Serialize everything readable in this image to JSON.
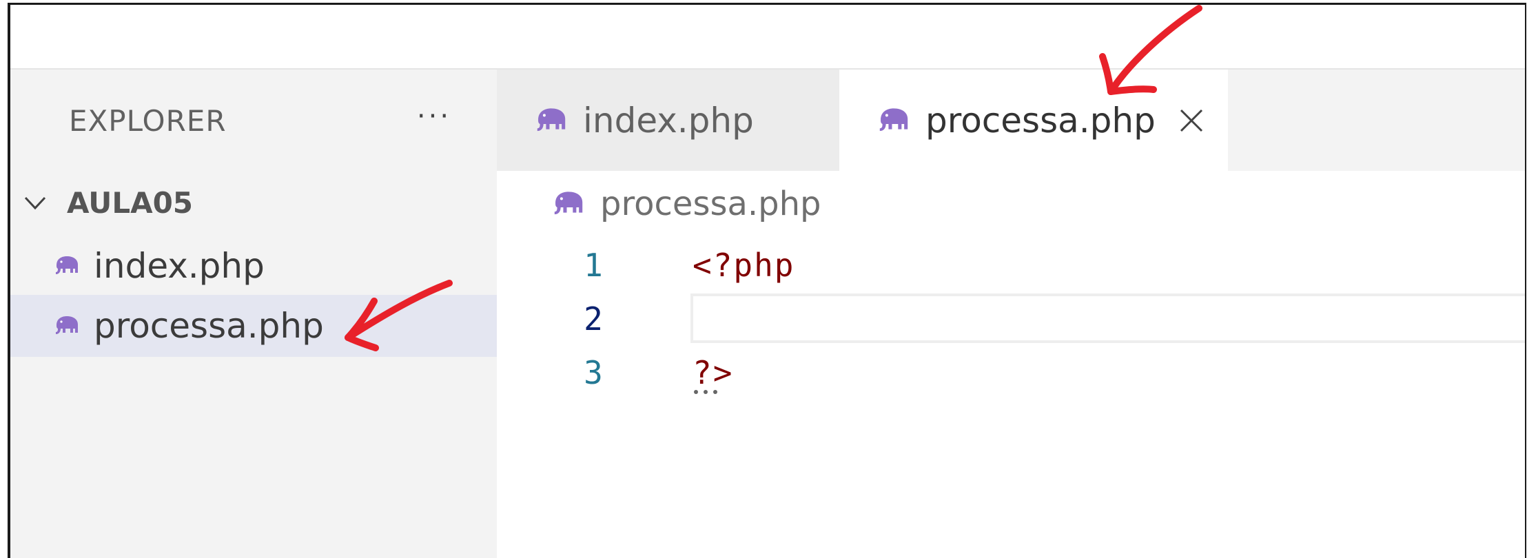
{
  "sidebar": {
    "title": "EXPLORER",
    "more_label": "···",
    "folder": {
      "name": "AULA05",
      "expanded": true
    },
    "files": [
      {
        "name": "index.php",
        "icon": "php-elephant-icon",
        "selected": false
      },
      {
        "name": "processa.php",
        "icon": "php-elephant-icon",
        "selected": true
      }
    ]
  },
  "tabs": [
    {
      "label": "index.php",
      "icon": "php-elephant-icon",
      "active": false
    },
    {
      "label": "processa.php",
      "icon": "php-elephant-icon",
      "active": true,
      "close_icon": "close-icon"
    }
  ],
  "breadcrumb": {
    "file": "processa.php",
    "icon": "php-elephant-icon"
  },
  "code": {
    "lines": [
      {
        "number": "1",
        "text": "<?php"
      },
      {
        "number": "2",
        "text": ""
      },
      {
        "number": "3",
        "text": "?>"
      }
    ],
    "current_line": 2
  },
  "colors": {
    "php_icon": "#8e6ec9",
    "annotation_arrow": "#e8212a",
    "code_keyword": "#800000",
    "line_number": "#237893",
    "sidebar_bg": "#f3f3f3",
    "selected_item_bg": "#e4e6f1"
  }
}
